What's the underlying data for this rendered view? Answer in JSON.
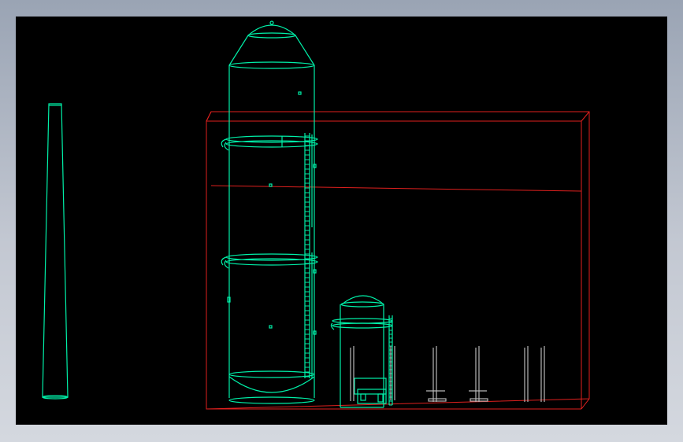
{
  "app": {
    "background_gradient": [
      "#9aa4b4",
      "#d4d8df"
    ],
    "viewport_background": "#000000"
  },
  "colors": {
    "wire": "#00f0a8",
    "bbox": "#e0201e",
    "gray_part": "#b8b8b8"
  },
  "scene": {
    "objects": [
      "chimney-stack",
      "absorption-tower",
      "small-tank",
      "bounding-box",
      "gray-fittings"
    ]
  }
}
